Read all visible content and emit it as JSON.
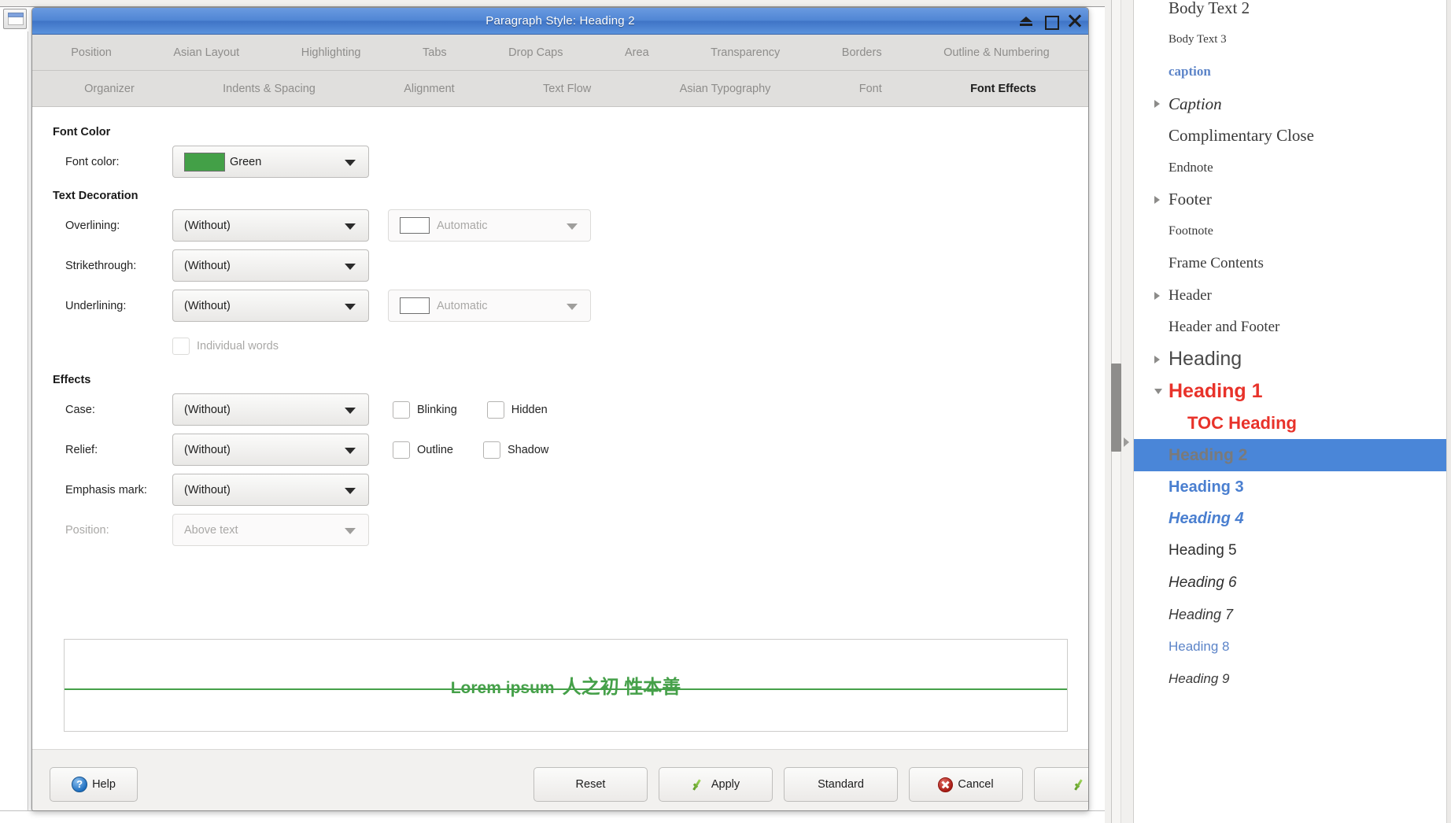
{
  "dialog": {
    "title": "Paragraph Style: Heading 2",
    "window_controls": [
      {
        "name": "shade-icon",
        "label": "Shade"
      },
      {
        "name": "maximize-icon",
        "label": "Maximize"
      },
      {
        "name": "close-icon",
        "label": "Close"
      }
    ],
    "tabs_row1": [
      "Position",
      "Asian Layout",
      "Highlighting",
      "Tabs",
      "Drop Caps",
      "Area",
      "Transparency",
      "Borders",
      "Outline & Numbering"
    ],
    "tabs_row2": [
      "Organizer",
      "Indents & Spacing",
      "Alignment",
      "Text Flow",
      "Asian Typography",
      "Font",
      "Font Effects"
    ],
    "active_tab": "Font Effects",
    "sections": {
      "font_color": {
        "title": "Font Color",
        "font_color_label": "Font color:",
        "font_color_value": "Green",
        "font_color_hex": "#43a047"
      },
      "text_decoration": {
        "title": "Text Decoration",
        "overlining_label": "Overlining:",
        "overlining_value": "(Without)",
        "overlining_color_value": "Automatic",
        "strikethrough_label": "Strikethrough:",
        "strikethrough_value": "(Without)",
        "underlining_label": "Underlining:",
        "underlining_value": "(Without)",
        "underlining_color_value": "Automatic",
        "individual_words_label": "Individual words"
      },
      "effects": {
        "title": "Effects",
        "case_label": "Case:",
        "case_value": "(Without)",
        "blinking_label": "Blinking",
        "hidden_label": "Hidden",
        "relief_label": "Relief:",
        "relief_value": "(Without)",
        "outline_label": "Outline",
        "shadow_label": "Shadow",
        "emphasis_label": "Emphasis mark:",
        "emphasis_value": "(Without)",
        "position_label": "Position:",
        "position_value": "Above text"
      }
    },
    "preview": {
      "latin_text": "Lorem ipsum",
      "cjk_text": "人之初 性本善",
      "text_color": "#45a049"
    },
    "buttons": {
      "help": "Help",
      "reset": "Reset",
      "apply": "Apply",
      "standard": "Standard",
      "cancel": "Cancel",
      "ok": "OK"
    }
  },
  "styles_panel": {
    "items": [
      {
        "label": "Body Text 2",
        "twisty": "none",
        "indent": 0,
        "font": "serif",
        "size": 21,
        "weight": "normal",
        "style": "normal",
        "color": "#3a3a3a"
      },
      {
        "label": "Body Text 3",
        "twisty": "none",
        "indent": 0,
        "font": "serif",
        "size": 15,
        "weight": "normal",
        "style": "normal",
        "color": "#3a3a3a"
      },
      {
        "label": "caption",
        "twisty": "none",
        "indent": 0,
        "font": "serif",
        "size": 17,
        "weight": "bold",
        "style": "normal",
        "color": "#5c84c8"
      },
      {
        "label": "Caption",
        "twisty": "collapsed",
        "indent": 0,
        "font": "serif",
        "size": 21,
        "weight": "normal",
        "style": "italic",
        "color": "#2f2f2f"
      },
      {
        "label": "Complimentary Close",
        "twisty": "none",
        "indent": 0,
        "font": "serif",
        "size": 21,
        "weight": "normal",
        "style": "normal",
        "color": "#3a3a3a"
      },
      {
        "label": "Endnote",
        "twisty": "none",
        "indent": 0,
        "font": "serif",
        "size": 17,
        "weight": "normal",
        "style": "normal",
        "color": "#3a3a3a"
      },
      {
        "label": "Footer",
        "twisty": "collapsed",
        "indent": 0,
        "font": "serif",
        "size": 21,
        "weight": "normal",
        "style": "normal",
        "color": "#3a3a3a"
      },
      {
        "label": "Footnote",
        "twisty": "none",
        "indent": 0,
        "font": "serif",
        "size": 16,
        "weight": "normal",
        "style": "normal",
        "color": "#3a3a3a"
      },
      {
        "label": "Frame Contents",
        "twisty": "none",
        "indent": 0,
        "font": "serif",
        "size": 19,
        "weight": "normal",
        "style": "normal",
        "color": "#3a3a3a"
      },
      {
        "label": "Header",
        "twisty": "collapsed",
        "indent": 0,
        "font": "serif",
        "size": 19,
        "weight": "normal",
        "style": "normal",
        "color": "#3a3a3a"
      },
      {
        "label": "Header and Footer",
        "twisty": "none",
        "indent": 0,
        "font": "serif",
        "size": 19,
        "weight": "normal",
        "style": "normal",
        "color": "#3a3a3a"
      },
      {
        "label": "Heading",
        "twisty": "collapsed",
        "indent": 0,
        "font": "sans",
        "size": 25,
        "weight": "normal",
        "style": "normal",
        "color": "#4a4a4a"
      },
      {
        "label": "Heading 1",
        "twisty": "expanded",
        "indent": 0,
        "font": "sans",
        "size": 25,
        "weight": "bold",
        "style": "normal",
        "color": "#e8322a"
      },
      {
        "label": "TOC Heading",
        "twisty": "none",
        "indent": 1,
        "font": "sans",
        "size": 22,
        "weight": "bold",
        "style": "normal",
        "color": "#e8322a"
      },
      {
        "label": "Heading 2",
        "twisty": "none",
        "indent": 0,
        "font": "sans",
        "size": 21,
        "weight": "bold",
        "style": "normal",
        "color": "#7a7a7a",
        "selected": true
      },
      {
        "label": "Heading 3",
        "twisty": "none",
        "indent": 0,
        "font": "sans",
        "size": 20,
        "weight": "bold",
        "style": "normal",
        "color": "#4a7fd0"
      },
      {
        "label": "Heading 4",
        "twisty": "none",
        "indent": 0,
        "font": "sans",
        "size": 20,
        "weight": "bold",
        "style": "italic",
        "color": "#4a7fd0"
      },
      {
        "label": "Heading 5",
        "twisty": "none",
        "indent": 0,
        "font": "sans",
        "size": 19,
        "weight": "normal",
        "style": "normal",
        "color": "#2f2f2f"
      },
      {
        "label": "Heading 6",
        "twisty": "none",
        "indent": 0,
        "font": "sans",
        "size": 19,
        "weight": "normal",
        "style": "italic",
        "color": "#2f2f2f"
      },
      {
        "label": "Heading 7",
        "twisty": "none",
        "indent": 0,
        "font": "sans",
        "size": 18,
        "weight": "normal",
        "style": "italic",
        "color": "#3a3a3a"
      },
      {
        "label": "Heading 8",
        "twisty": "none",
        "indent": 0,
        "font": "sans",
        "size": 17,
        "weight": "normal",
        "style": "normal",
        "color": "#5c84c8"
      },
      {
        "label": "Heading 9",
        "twisty": "none",
        "indent": 0,
        "font": "sans",
        "size": 17,
        "weight": "normal",
        "style": "italic",
        "color": "#3a3a3a"
      }
    ]
  }
}
